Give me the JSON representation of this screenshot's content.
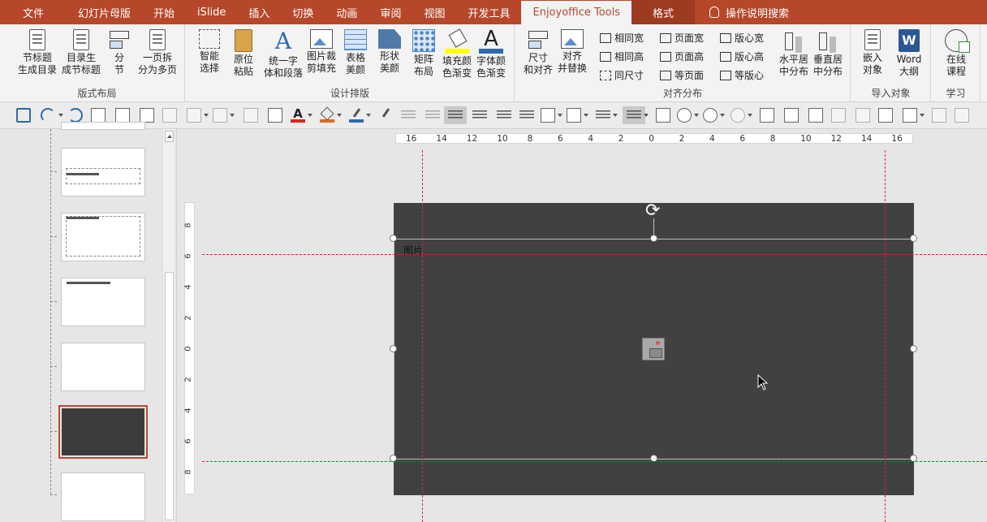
{
  "tabs": [
    {
      "label": "文件"
    },
    {
      "label": "幻灯片母版"
    },
    {
      "label": "开始"
    },
    {
      "label": "iSlide"
    },
    {
      "label": "插入"
    },
    {
      "label": "切换"
    },
    {
      "label": "动画"
    },
    {
      "label": "审阅"
    },
    {
      "label": "视图"
    },
    {
      "label": "开发工具"
    },
    {
      "label": "Enjoyoffice Tools"
    },
    {
      "label": "格式"
    }
  ],
  "tell_me": "操作说明搜索",
  "ribbon": {
    "groups": {
      "layout": "版式布局",
      "design": "设计排版",
      "align": "对齐分布",
      "import": "导入对象",
      "learn": "学习"
    },
    "buttons": {
      "section_title": "节标题\n生成目录",
      "toc_section": "目录生\n成节标题",
      "split_section": "分\n节",
      "split_pages": "一页拆\n分为多页",
      "smart_select": "智能\n选择",
      "paste_in_place": "原位\n粘贴",
      "unify_font": "统一字\n体和段落",
      "crop_fill": "图片裁\n剪填充",
      "table_beautify": "表格\n美颜",
      "shape_beautify": "形状\n美颜",
      "matrix_layout": "矩阵\n布局",
      "fill_gradient": "填充颜\n色渐变",
      "font_gradient": "字体颜\n色渐变",
      "size_align": "尺寸\n和对齐",
      "align_replace": "对齐\n并替换",
      "h_center": "水平居\n中分布",
      "v_center": "垂直居\n中分布",
      "embed_object": "嵌入\n对象",
      "word_outline": "Word\n大纲",
      "online_course": "在线\n课程"
    },
    "small": {
      "same_width": "相同宽",
      "same_height": "相同高",
      "same_size": "同尺寸",
      "page_width": "页面宽",
      "page_height": "页面高",
      "same_page": "等页面",
      "core_width": "版心宽",
      "core_height": "版心高",
      "same_core": "等版心"
    }
  },
  "ruler": {
    "h_ticks": [
      "16",
      "14",
      "12",
      "10",
      "8",
      "6",
      "4",
      "2",
      "0",
      "2",
      "4",
      "6",
      "8",
      "10",
      "12",
      "14",
      "16"
    ],
    "v_ticks": [
      "8",
      "6",
      "4",
      "2",
      "0",
      "2",
      "4",
      "6",
      "8"
    ]
  },
  "slide": {
    "placeholder_label": "图片",
    "background": "#414141",
    "guide_color": "#e0262b"
  },
  "colors": {
    "accent": "#b7472a",
    "ribbon_bg": "#f3f3f3"
  }
}
